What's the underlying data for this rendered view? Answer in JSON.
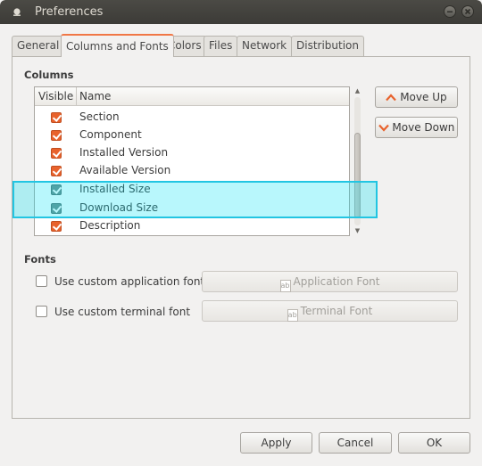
{
  "window": {
    "title": "Preferences"
  },
  "tabs": [
    {
      "label": "General"
    },
    {
      "label": "Columns and Fonts"
    },
    {
      "label": "Colors"
    },
    {
      "label": "Files"
    },
    {
      "label": "Network"
    },
    {
      "label": "Distribution"
    }
  ],
  "columns_section": {
    "heading": "Columns",
    "header_visible": "Visible",
    "header_name": "Name",
    "rows": [
      {
        "label": "Section",
        "checked": true
      },
      {
        "label": "Component",
        "checked": true
      },
      {
        "label": "Installed Version",
        "checked": true
      },
      {
        "label": "Available Version",
        "checked": true
      },
      {
        "label": "Installed Size",
        "checked": true
      },
      {
        "label": "Download Size",
        "checked": true
      },
      {
        "label": "Description",
        "checked": true
      }
    ],
    "move_up_label": "Move Up",
    "move_down_label": "Move Down"
  },
  "fonts_section": {
    "heading": "Fonts",
    "custom_app_font_label": "Use custom application font",
    "custom_terminal_font_label": "Use custom terminal font",
    "app_font_button": "Application Font",
    "terminal_font_button": "Terminal Font",
    "font_button_icon_text": "ab"
  },
  "footer": {
    "apply_label": "Apply",
    "cancel_label": "Cancel",
    "ok_label": "OK"
  },
  "colors": {
    "accent": "#e8622c",
    "highlight": "#22c5e2"
  }
}
